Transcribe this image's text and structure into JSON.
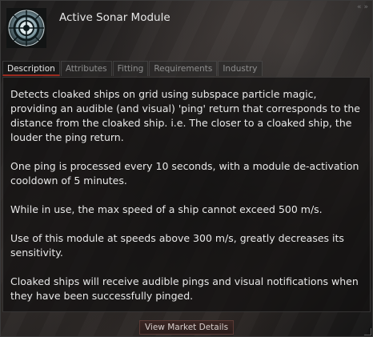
{
  "window": {
    "controls": [
      "«",
      "»"
    ]
  },
  "item": {
    "title": "Active Sonar Module",
    "icon": "sonar-module-icon"
  },
  "tabs": [
    {
      "label": "Description",
      "active": true
    },
    {
      "label": "Attributes",
      "active": false
    },
    {
      "label": "Fitting",
      "active": false
    },
    {
      "label": "Requirements",
      "active": false
    },
    {
      "label": "Industry",
      "active": false
    }
  ],
  "description": {
    "paragraphs": [
      "Detects cloaked ships on grid using subspace particle magic, providing an audible (and visual) 'ping' return that corresponds to the distance from the cloaked ship.  i.e. The closer to a cloaked ship, the louder the ping return.",
      "One ping is processed every 10 seconds, with a module de-activation cooldown of 5 minutes.",
      "While in use, the max speed of a ship cannot exceed 500 m/s.",
      "Use of this module at speeds above 300 m/s, greatly decreases its sensitivity.",
      "Cloaked ships will receive audible pings and visual notifications when they have been successfully pinged."
    ]
  },
  "footer": {
    "market_button_label": "View Market Details"
  },
  "colors": {
    "accent": "#9b2a1f",
    "text": "#e8e8e8",
    "tab_inactive": "#8d8d8d"
  }
}
